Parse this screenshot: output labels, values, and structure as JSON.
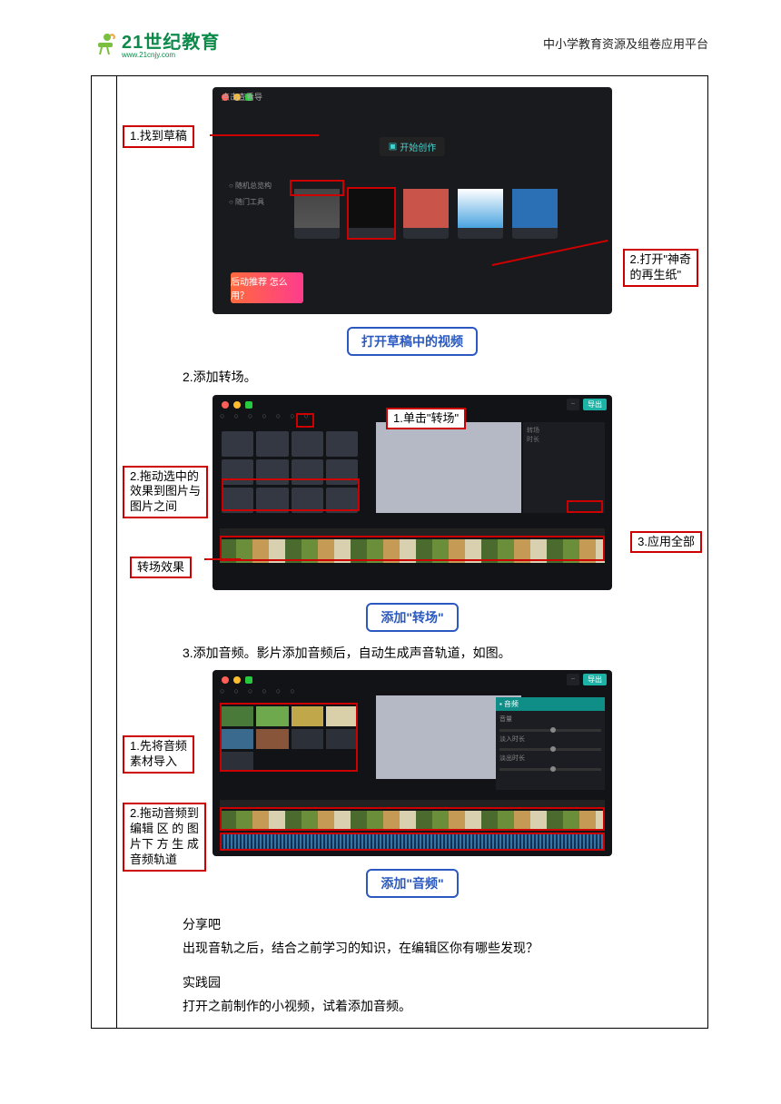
{
  "header": {
    "brand": "21世纪教育",
    "url": "www.21cnjy.com",
    "right": "中小学教育资源及组卷应用平台"
  },
  "fig1": {
    "menu": "点击查看导",
    "newBtn": "开始创作",
    "banner": "后动推荐\n怎么用？",
    "sideA": "○ 随机总览构",
    "sideB": "○ 随门工具",
    "callout1": "1.找到草稿",
    "callout2": "2.打开\"神奇\n的再生纸\"",
    "caption": "打开草稿中的视频"
  },
  "step2": "2.添加转场。",
  "fig2": {
    "callout1": "1.单击\"转场\"",
    "callout2": "2.拖动选中的\n效果到图片与\n图片之间",
    "callout3": "3.应用全部",
    "callout4": "转场效果",
    "caption": "添加\"转场\""
  },
  "step3": "3.添加音频。影片添加音频后，自动生成声音轨道，如图。",
  "fig3": {
    "callout1": "1.先将音频\n素材导入",
    "callout2": "2.拖动音频到\n编辑 区 的 图\n片下 方 生 成\n音频轨道",
    "caption": "添加\"音频\"",
    "audioPanel": "音频"
  },
  "share": {
    "h": "分享吧",
    "p": "出现音轨之后，结合之前学习的知识，在编辑区你有哪些发现？"
  },
  "practice": {
    "h": "实践园",
    "p": "打开之前制作的小视频，试着添加音频。"
  }
}
